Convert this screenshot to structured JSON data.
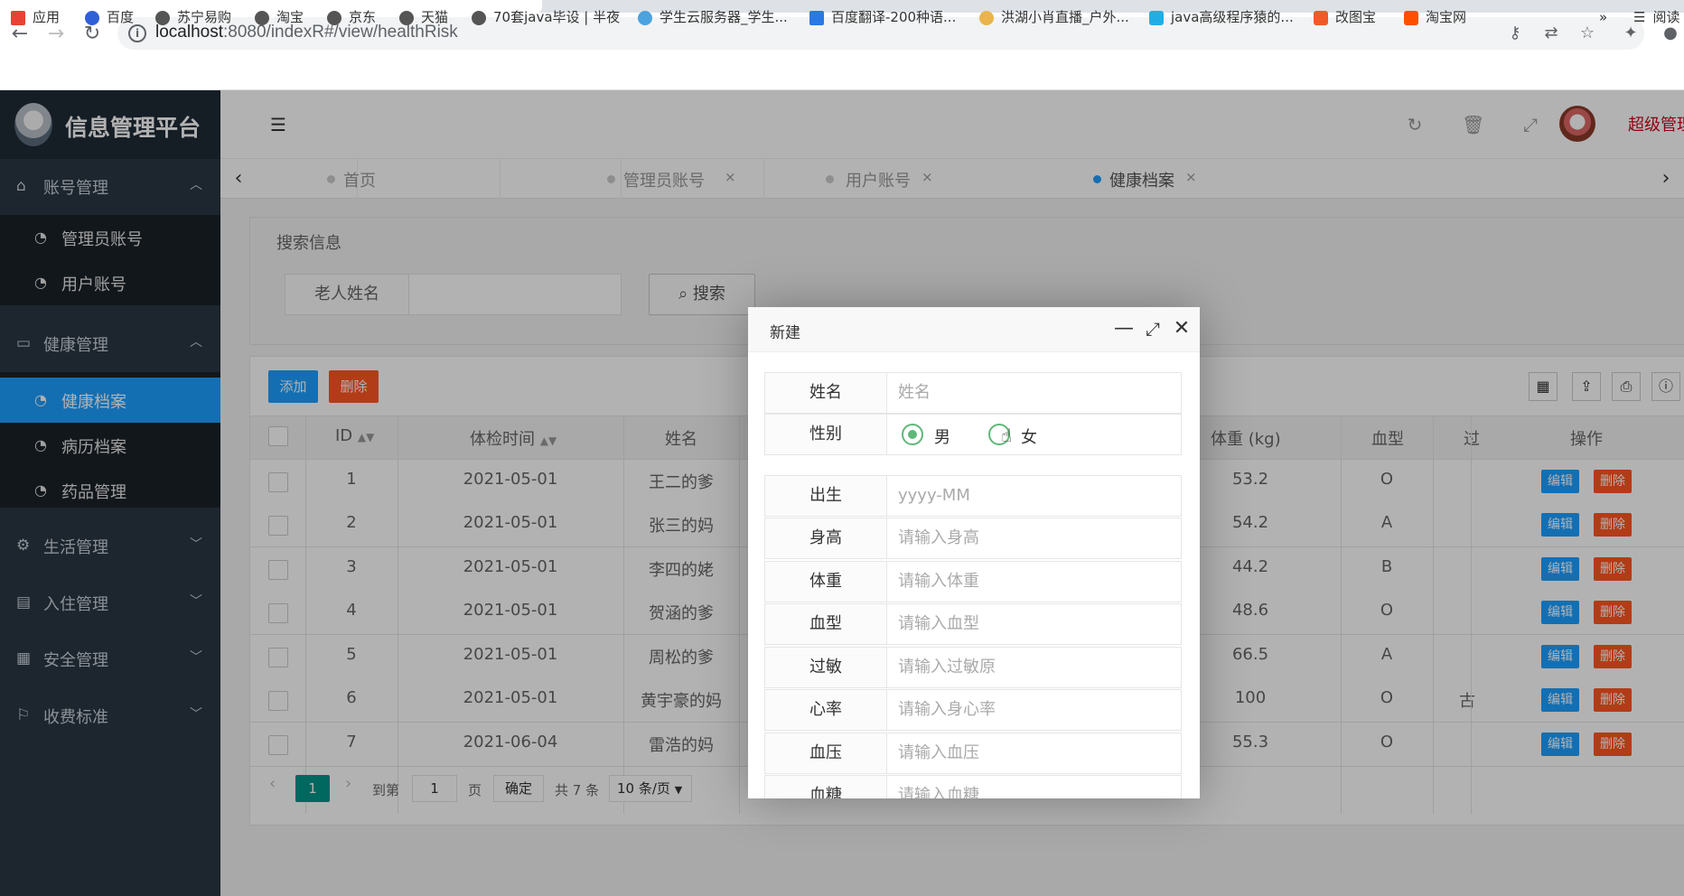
{
  "browser": {
    "url_host": "localhost",
    "url_rest": ":8080/indexR#/view/healthRisk",
    "bookmarks": [
      "应用",
      "百度",
      "苏宁易购",
      "淘宝",
      "京东",
      "天猫",
      "70套java毕设 | 半夜",
      "学生云服务器_学生...",
      "百度翻译-200种语...",
      "洪湖小肖直播_户外...",
      "java高级程序猿的...",
      "改图宝",
      "淘宝网"
    ],
    "bookmarks_more": "»",
    "reading_list": "阅读"
  },
  "app": {
    "title": "信息管理平台",
    "admin_name": "超级管理"
  },
  "sidebar": {
    "groups": [
      {
        "label": "账号管理",
        "icon": "home-icon"
      },
      {
        "label": "健康管理",
        "icon": "window-icon"
      },
      {
        "label": "生活管理",
        "icon": "gears-icon"
      },
      {
        "label": "入住管理",
        "icon": "file-icon"
      },
      {
        "label": "安全管理",
        "icon": "calendar-icon"
      },
      {
        "label": "收费标准",
        "icon": "flag-icon"
      }
    ],
    "account_items": [
      "管理员账号",
      "用户账号"
    ],
    "health_items": [
      "健康档案",
      "病历档案",
      "药品管理"
    ]
  },
  "tabs": [
    {
      "label": "首页"
    },
    {
      "label": "管理员账号",
      "close": "×"
    },
    {
      "label": "用户账号",
      "close": "×"
    },
    {
      "label": "健康档案",
      "close": "×"
    }
  ],
  "search": {
    "legend": "搜索信息",
    "field_label": "老人姓名",
    "button": "搜索"
  },
  "toolbar": {
    "add": "添加",
    "delete": "删除"
  },
  "table": {
    "headers": {
      "id": "ID",
      "date": "体检时间",
      "name": "姓名",
      "weight": "体重 (kg)",
      "blood": "血型",
      "allergy": "过",
      "actions": "操作"
    },
    "rows": [
      {
        "id": "1",
        "date": "2021-05-01",
        "name": "王二的爹",
        "weight": "53.2",
        "blood": "O",
        "allergy": ""
      },
      {
        "id": "2",
        "date": "2021-05-01",
        "name": "张三的妈",
        "weight": "54.2",
        "blood": "A",
        "allergy": ""
      },
      {
        "id": "3",
        "date": "2021-05-01",
        "name": "李四的姥",
        "weight": "44.2",
        "blood": "B",
        "allergy": ""
      },
      {
        "id": "4",
        "date": "2021-05-01",
        "name": "贺涵的爹",
        "weight": "48.6",
        "blood": "O",
        "allergy": ""
      },
      {
        "id": "5",
        "date": "2021-05-01",
        "name": "周松的爹",
        "weight": "66.5",
        "blood": "A",
        "allergy": ""
      },
      {
        "id": "6",
        "date": "2021-05-01",
        "name": "黄宇豪的妈",
        "weight": "100",
        "blood": "O",
        "allergy": "古"
      },
      {
        "id": "7",
        "date": "2021-06-04",
        "name": "雷浩的妈",
        "weight": "55.3",
        "blood": "O",
        "allergy": ""
      }
    ],
    "edit_label": "编辑",
    "delete_label": "删除"
  },
  "pager": {
    "current": "1",
    "goto_prefix": "到第",
    "goto_value": "1",
    "goto_suffix": "页",
    "confirm": "确定",
    "total": "共 7 条",
    "page_size": "10 条/页"
  },
  "modal": {
    "title": "新建",
    "fields": [
      {
        "label": "姓名",
        "placeholder": "姓名"
      },
      {
        "label": "出生",
        "placeholder": "yyyy-MM"
      },
      {
        "label": "身高",
        "placeholder": "请输入身高"
      },
      {
        "label": "体重",
        "placeholder": "请输入体重"
      },
      {
        "label": "血型",
        "placeholder": "请输入血型"
      },
      {
        "label": "过敏",
        "placeholder": "请输入过敏原"
      },
      {
        "label": "心率",
        "placeholder": "请输入身心率"
      },
      {
        "label": "血压",
        "placeholder": "请输入血压"
      },
      {
        "label": "血糖",
        "placeholder": "请输入血糖"
      }
    ],
    "gender": {
      "label": "性别",
      "options": [
        "男",
        "女"
      ],
      "selected": "男"
    }
  },
  "colors": {
    "primary": "#1e9fff",
    "danger": "#ff5722",
    "sidebar": "#2a3542",
    "pager_active": "#009688"
  }
}
